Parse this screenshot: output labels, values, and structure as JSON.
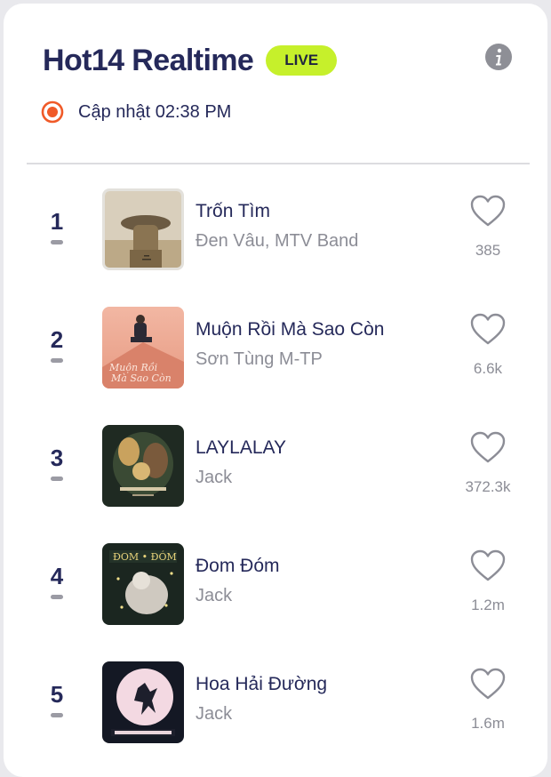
{
  "header": {
    "title": "Hot14 Realtime",
    "live_badge": "LIVE",
    "info_icon": "info-icon"
  },
  "update": {
    "text": "Cập nhật 02:38 PM",
    "icon": "record-icon"
  },
  "colors": {
    "title": "#25295a",
    "live_badge_bg": "#c6f02b",
    "record_red": "#f05a28",
    "muted": "#8c8d96",
    "heart_stroke": "#8c8d96"
  },
  "tracks": [
    {
      "rank": "1",
      "title": "Trốn Tìm",
      "artist": "Đen Vâu, MTV Band",
      "likes": "385"
    },
    {
      "rank": "2",
      "title": "Muộn Rồi Mà Sao Còn",
      "artist": "Sơn Tùng M-TP",
      "likes": "6.6k"
    },
    {
      "rank": "3",
      "title": "LAYLALAY",
      "artist": "Jack",
      "likes": "372.3k"
    },
    {
      "rank": "4",
      "title": "Đom Đóm",
      "artist": "Jack",
      "likes": "1.2m"
    },
    {
      "rank": "5",
      "title": "Hoa Hải Đường",
      "artist": "Jack",
      "likes": "1.6m"
    }
  ]
}
